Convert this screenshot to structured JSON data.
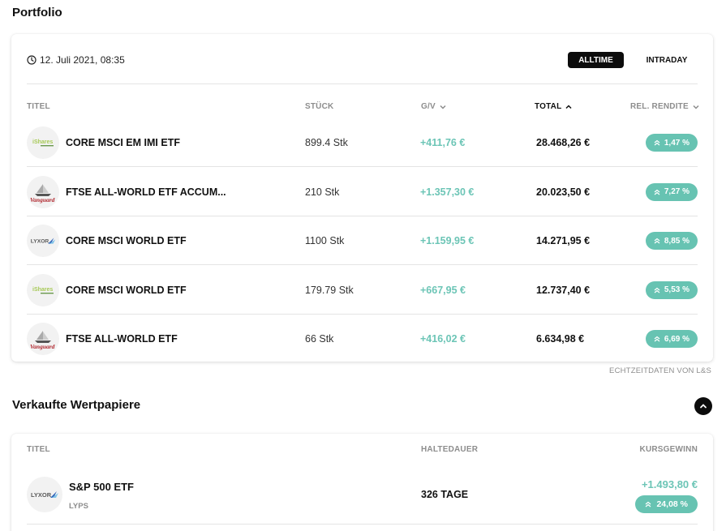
{
  "portfolio": {
    "title": "Portfolio",
    "date": "12. Juli 2021, 08:35",
    "toggles": {
      "alltime": "ALLTIME",
      "intraday": "INTRADAY"
    },
    "columns": {
      "title": "TITEL",
      "qty": "STÜCK",
      "gv": "G/V",
      "total": "TOTAL",
      "rendite": "REL. RENDITE"
    },
    "rows": [
      {
        "logo": "ishares-logo",
        "name": "CORE MSCI EM IMI ETF",
        "qty": "899.4 Stk",
        "gv": "+411,76 €",
        "total": "28.468,26 €",
        "rendite": "1,47 %"
      },
      {
        "logo": "vanguard-logo",
        "name": "FTSE ALL-WORLD ETF ACCUM...",
        "qty": "210 Stk",
        "gv": "+1.357,30 €",
        "total": "20.023,50 €",
        "rendite": "7,27 %"
      },
      {
        "logo": "lyxor-logo",
        "name": "CORE MSCI WORLD ETF",
        "qty": "1100 Stk",
        "gv": "+1.159,95 €",
        "total": "14.271,95 €",
        "rendite": "8,85 %"
      },
      {
        "logo": "ishares-logo",
        "name": "CORE MSCI WORLD ETF",
        "qty": "179.79 Stk",
        "gv": "+667,95 €",
        "total": "12.737,40 €",
        "rendite": "5,53 %"
      },
      {
        "logo": "vanguard-logo",
        "name": "FTSE ALL-WORLD ETF",
        "qty": "66 Stk",
        "gv": "+416,02 €",
        "total": "6.634,98 €",
        "rendite": "6,69 %"
      }
    ],
    "realtime_note": "ECHTZEITDATEN VON L&S"
  },
  "sold": {
    "title": "Verkaufte Wertpapiere",
    "columns": {
      "title": "TITEL",
      "hold": "HALTEDAUER",
      "gain": "KURSGEWINN"
    },
    "rows": [
      {
        "logo": "lyxor-logo",
        "name": "S&P 500 ETF",
        "ticker": "LYPS",
        "hold": "326 TAGE",
        "gain": "+1.493,80 €",
        "rendite": "24,08 %"
      }
    ]
  },
  "colors": {
    "accent": "#67c3b2",
    "gain_text": "#6cc5b6",
    "dark": "#0c0c0c",
    "muted": "#8d8d8d"
  }
}
